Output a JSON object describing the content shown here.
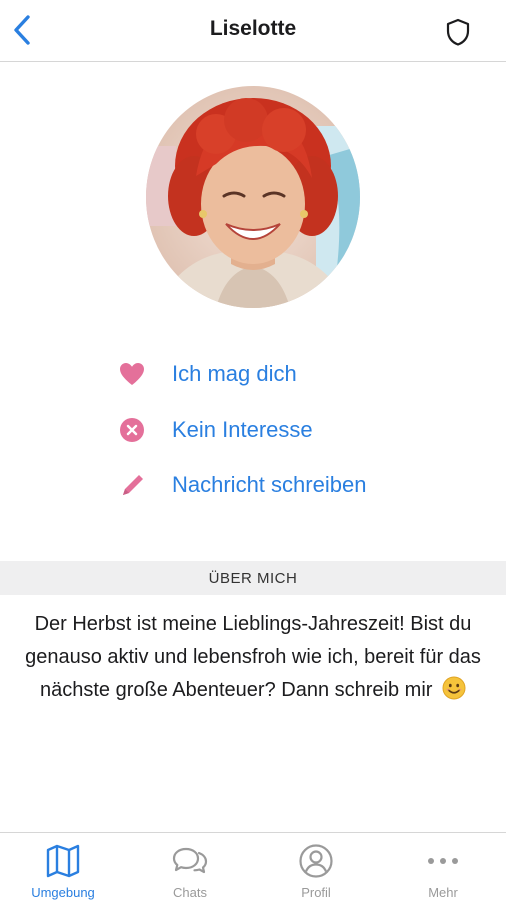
{
  "nav": {
    "title": "Liselotte",
    "back_icon": "chevron-left-icon",
    "shield_icon": "shield-icon",
    "accent": "#2a7fe0"
  },
  "profile": {
    "avatar_icon": "profile-photo"
  },
  "actions": [
    {
      "label": "Ich mag dich",
      "icon": "heart-icon"
    },
    {
      "label": "Kein Interesse",
      "icon": "x-circle-icon"
    },
    {
      "label": "Nachricht schreiben",
      "icon": "pencil-icon"
    }
  ],
  "section": {
    "title": "ÜBER MICH"
  },
  "about": {
    "text": "Der Herbst ist meine Lieblings-Jahreszeit! Bist du genauso aktiv und lebensfroh wie ich, bereit für das nächste große Abenteuer? Dann schreib mir"
  },
  "colors": {
    "pink": "#e4709a",
    "blue": "#2a7fe0",
    "gray": "#9a9a9a"
  },
  "tabs": [
    {
      "label": "Umgebung",
      "icon": "map-icon",
      "active": true
    },
    {
      "label": "Chats",
      "icon": "chat-bubbles-icon",
      "active": false
    },
    {
      "label": "Profil",
      "icon": "person-circle-icon",
      "active": false
    },
    {
      "label": "Mehr",
      "icon": "more-icon",
      "active": false
    }
  ]
}
